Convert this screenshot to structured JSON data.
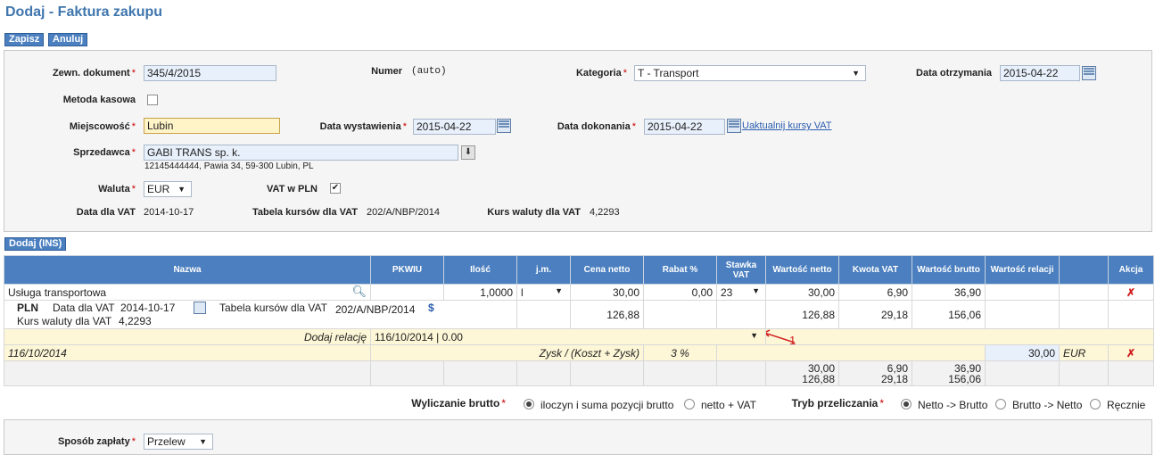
{
  "page": {
    "title": "Dodaj - Faktura zakupu"
  },
  "toolbar": {
    "save_label": "Zapisz",
    "cancel_label": "Anuluj"
  },
  "form": {
    "ext_doc_label": "Zewn. dokument",
    "ext_doc_value": "345/4/2015",
    "number_label": "Numer",
    "number_value": "(auto)",
    "category_label": "Kategoria",
    "category_value": "T - Transport",
    "received_label": "Data otrzymania",
    "received_value": "2015-04-22",
    "cash_method_label": "Metoda kasowa",
    "city_label": "Miejscowość",
    "city_value": "Lubin",
    "issue_date_label": "Data wystawienia",
    "issue_date_value": "2015-04-22",
    "done_date_label": "Data dokonania",
    "done_date_value": "2015-04-22",
    "update_vat_rates_link": "Uaktualnij kursy VAT",
    "seller_label": "Sprzedawca",
    "seller_value": "GABI TRANS sp. k.",
    "seller_address": "12145444444, Pawia 34, 59-300 Lubin, PL",
    "currency_label": "Waluta",
    "currency_value": "EUR",
    "vat_pln_label": "VAT w PLN",
    "vat_date_label": "Data dla VAT",
    "vat_date_value": "2014-10-17",
    "rates_table_label": "Tabela kursów dla VAT",
    "rates_table_value": "202/A/NBP/2014",
    "rate_label": "Kurs waluty dla VAT",
    "rate_value": "4,2293"
  },
  "add_button": "Dodaj (INS)",
  "table": {
    "headers": {
      "name": "Nazwa",
      "pkwiu": "PKWIU",
      "qty": "Ilość",
      "unit": "j.m.",
      "net_price": "Cena netto",
      "discount": "Rabat %",
      "vat_rate": "Stawka VAT",
      "net_value": "Wartość netto",
      "vat_amount": "Kwota VAT",
      "gross_value": "Wartość brutto",
      "relation_value": "Wartość relacji",
      "action": "Akcja"
    },
    "row": {
      "name": "Usługa transportowa",
      "qty": "1,0000",
      "unit": "l",
      "net_price": "30,00",
      "discount": "0,00",
      "vat_rate": "23",
      "net_value": "30,00",
      "vat_amount": "6,90",
      "gross_value": "36,90"
    },
    "pln_row": {
      "currency": "PLN",
      "vat_date_label": "Data dla VAT",
      "vat_date_value": "2014-10-17",
      "rates_table_label": "Tabela kursów dla VAT",
      "rates_table_value": "202/A/NBP/2014",
      "dollar": "$",
      "rate_label": "Kurs waluty dla VAT",
      "rate_value": "4,2293",
      "net_price": "126,88",
      "net_value": "126,88",
      "vat_amount": "29,18",
      "gross_value": "156,06"
    },
    "relation_row": {
      "label": "Dodaj relację",
      "value": "116/10/2014 | 0.00",
      "annotation": "1"
    },
    "relation_line": {
      "name": "116/10/2014",
      "formula": "Zysk / (Koszt + Zysk)",
      "percent": "3 %",
      "value": "30,00",
      "currency": "EUR"
    },
    "totals": {
      "net_eur": "30,00",
      "net_pln": "126,88",
      "vat_eur": "6,90",
      "vat_pln": "29,18",
      "gross_eur": "36,90",
      "gross_pln": "156,06"
    }
  },
  "options": {
    "gross_calc_label": "Wyliczanie brutto",
    "gross_opt1": "iloczyn i suma pozycji brutto",
    "gross_opt2": "netto + VAT",
    "recalc_label": "Tryb przeliczania",
    "recalc_opt1": "Netto -> Brutto",
    "recalc_opt2": "Brutto -> Netto",
    "recalc_opt3": "Ręcznie"
  },
  "payment": {
    "method_label": "Sposób zapłaty",
    "method_value": "Przelew"
  }
}
